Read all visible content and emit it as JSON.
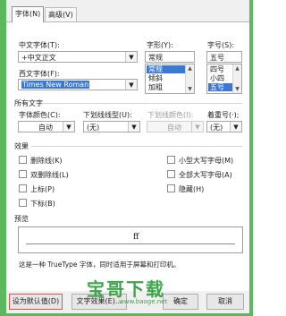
{
  "tabs": [
    "字体(N)",
    "高级(V)"
  ],
  "chinese_font": {
    "label": "中文字体(T):",
    "value": "+中文正文"
  },
  "western_font": {
    "label": "西文字体(F):",
    "value": "Times New Roman"
  },
  "style": {
    "label": "字形(Y):",
    "value": "常规",
    "items": [
      "常规",
      "倾斜",
      "加粗"
    ],
    "selected": 0
  },
  "size": {
    "label": "字号(S):",
    "value": "五号",
    "items": [
      "四号",
      "小四",
      "五号"
    ],
    "selected": 2
  },
  "all_text": {
    "title": "所有文字",
    "font_color": {
      "label": "字体颜色(C):",
      "value": "自动"
    },
    "underline_type": {
      "label": "下划线线型(U):",
      "value": "(无)"
    },
    "underline_color": {
      "label": "下划线颜色(I):",
      "value": "自动"
    },
    "emphasis": {
      "label": "着重号(·);",
      "value": "(无)"
    }
  },
  "effects": {
    "title": "效果",
    "left": [
      "删除线(K)",
      "双删除线(L)",
      "上标(P)",
      "下标(B)"
    ],
    "right": [
      "小型大写字母(M)",
      "全部大写字母(A)",
      "隐藏(H)"
    ]
  },
  "preview": {
    "title": "预览",
    "sample": "ff",
    "note": "这是一种 TrueType 字体，同时适用于屏幕和打印机。"
  },
  "buttons": {
    "default": "设为默认值(D)",
    "text_effects": "文字效果(E)...",
    "ok": "确定",
    "cancel": "取消"
  },
  "watermark": {
    "brand": "宝哥下载",
    "url": "www.baoge.net"
  },
  "colors": {
    "accent": "#3b78d6",
    "frame": "#5cb85c",
    "highlight": "#d9534f",
    "watermark": "#3ea44a"
  }
}
